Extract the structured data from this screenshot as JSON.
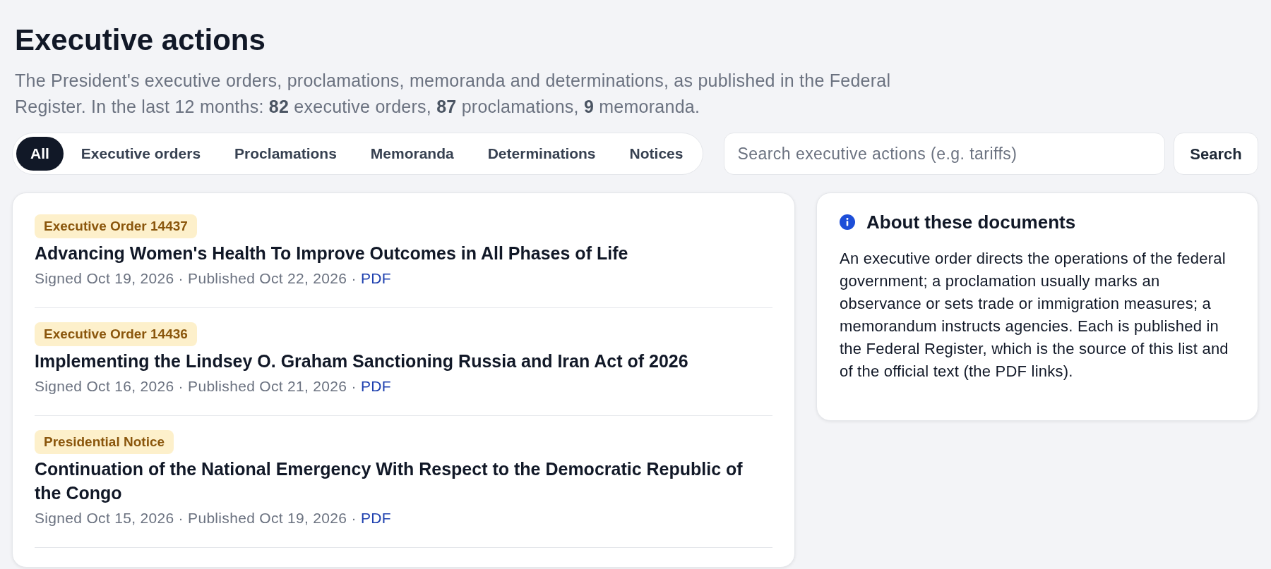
{
  "header": {
    "title": "Executive actions",
    "description": "The President's executive orders, proclamations, memoranda and determinations, as published in the Federal Register. In the last 12 months: **82** executive orders, **87** proclamations, **9** memoranda."
  },
  "filter_tabs": [
    {
      "label": "All",
      "selected": true
    },
    {
      "label": "Executive orders",
      "selected": false
    },
    {
      "label": "Proclamations",
      "selected": false
    },
    {
      "label": "Memoranda",
      "selected": false
    },
    {
      "label": "Determinations",
      "selected": false
    },
    {
      "label": "Notices",
      "selected": false
    }
  ],
  "search": {
    "placeholder": "Search executive actions (e.g. tariffs)",
    "button": "Search"
  },
  "documents": [
    {
      "badge": "Executive Order 14437",
      "title": "Advancing Women's Health To Improve Outcomes in All Phases of Life",
      "dates": "Signed Oct 19, 2026 · Published Oct 22, 2026 ·",
      "link": "PDF"
    },
    {
      "badge": "Executive Order 14436",
      "title": "Implementing the Lindsey O. Graham Sanctioning Russia and Iran Act of 2026",
      "dates": "Signed Oct 16, 2026 · Published Oct 21, 2026 ·",
      "link": "PDF"
    },
    {
      "badge": "Presidential Notice",
      "title": "Continuation of the National Emergency With Respect to the Democratic Republic of the Congo",
      "dates": "Signed Oct 15, 2026 · Published Oct 19, 2026 ·",
      "link": "PDF"
    }
  ],
  "about": {
    "title": "About these documents",
    "text": "An executive order directs the operations of the federal government; a proclamation usually marks an observance or sets trade or immigration measures; a memorandum instructs agencies. Each is published in the Federal Register, which is the source of this list and of the official text (the PDF links)."
  }
}
